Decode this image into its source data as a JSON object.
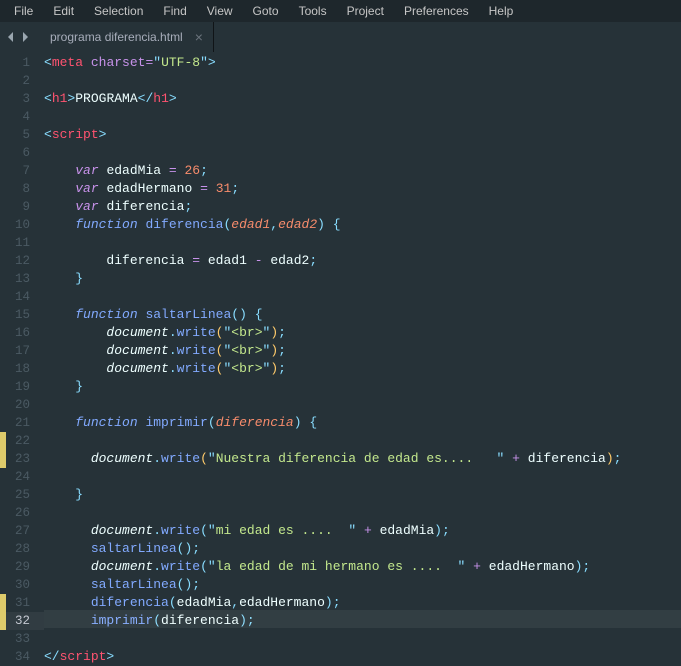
{
  "menu": {
    "items": [
      "File",
      "Edit",
      "Selection",
      "Find",
      "View",
      "Goto",
      "Tools",
      "Project",
      "Preferences",
      "Help"
    ]
  },
  "tab": {
    "name": "programa diferencia.html"
  },
  "gutter_total": 34,
  "active_line": 32,
  "dirty_lines": [
    22,
    23,
    31,
    32
  ],
  "code_lines": [
    "<span class='punct'>&lt;</span><span class='tag'>meta</span> <span class='attr'>charset</span><span class='op'>=</span><span class='punct'>\"</span><span class='str'>UTF-8</span><span class='punct'>\"</span><span class='punct'>&gt;</span>",
    "",
    "<span class='punct'>&lt;</span><span class='tag'>h1</span><span class='punct'>&gt;</span><span class='txt'>PROGRAMA</span><span class='punct'>&lt;/</span><span class='tag'>h1</span><span class='punct'>&gt;</span>",
    "",
    "<span class='punct'>&lt;</span><span class='tag'>script</span><span class='punct'>&gt;</span>",
    "",
    "    <span class='kw'>var</span> <span class='var'>edadMia</span> <span class='op'>=</span> <span class='num'>26</span><span class='punct'>;</span>",
    "    <span class='kw'>var</span> <span class='var'>edadHermano</span> <span class='op'>=</span> <span class='num'>31</span><span class='punct'>;</span>",
    "    <span class='kw'>var</span> <span class='var'>diferencia</span><span class='punct'>;</span>",
    "    <span class='vf'>function</span> <span class='fn'>diferencia</span><span class='bracket'>(</span><span class='param'>edad1</span><span class='punct'>,</span><span class='param'>edad2</span><span class='bracket'>)</span> <span class='bracket'>{</span>",
    "",
    "        <span class='var'>diferencia</span> <span class='op'>=</span> <span class='var'>edad1</span> <span class='op'>-</span> <span class='var'>edad2</span><span class='punct'>;</span>",
    "    <span class='bracket'>}</span>",
    "",
    "    <span class='vf'>function</span> <span class='fn'>saltarLinea</span><span class='bracket'>(</span><span class='bracket'>)</span> <span class='bracket'>{</span>",
    "        <span class='obj'>document</span><span class='punct'>.</span><span class='fn'>write</span><span class='bracket-a'>(</span><span class='punct'>\"</span><span class='str'>&lt;br&gt;</span><span class='punct'>\"</span><span class='bracket-a'>)</span><span class='punct'>;</span>",
    "        <span class='obj'>document</span><span class='punct'>.</span><span class='fn'>write</span><span class='bracket-a'>(</span><span class='punct'>\"</span><span class='str'>&lt;br&gt;</span><span class='punct'>\"</span><span class='bracket-a'>)</span><span class='punct'>;</span>",
    "        <span class='obj'>document</span><span class='punct'>.</span><span class='fn'>write</span><span class='bracket-a'>(</span><span class='punct'>\"</span><span class='str'>&lt;br&gt;</span><span class='punct'>\"</span><span class='bracket-a'>)</span><span class='punct'>;</span>",
    "    <span class='bracket'>}</span>",
    "",
    "    <span class='vf'>function</span> <span class='fn'>imprimir</span><span class='bracket'>(</span><span class='param'>diferencia</span><span class='bracket'>)</span> <span class='bracket'>{</span>",
    "",
    "      <span class='obj'>document</span><span class='punct'>.</span><span class='fn'>write</span><span class='bracket-a'>(</span><span class='punct'>\"</span><span class='str'>Nuestra diferencia de edad es....   </span><span class='punct'>\"</span> <span class='op'>+</span> <span class='var'>diferencia</span><span class='bracket-a'>)</span><span class='punct'>;</span>",
    "",
    "    <span class='bracket'>}</span>",
    "",
    "      <span class='obj'>document</span><span class='punct'>.</span><span class='fn'>write</span><span class='bracket'>(</span><span class='punct'>\"</span><span class='str'>mi edad es ....  </span><span class='punct'>\"</span> <span class='op'>+</span> <span class='var'>edadMia</span><span class='bracket'>)</span><span class='punct'>;</span>",
    "      <span class='fn'>saltarLinea</span><span class='bracket'>(</span><span class='bracket'>)</span><span class='punct'>;</span>",
    "      <span class='obj'>document</span><span class='punct'>.</span><span class='fn'>write</span><span class='bracket'>(</span><span class='punct'>\"</span><span class='str'>la edad de mi hermano es ....  </span><span class='punct'>\"</span> <span class='op'>+</span> <span class='var'>edadHermano</span><span class='bracket'>)</span><span class='punct'>;</span>",
    "      <span class='fn'>saltarLinea</span><span class='bracket'>(</span><span class='bracket'>)</span><span class='punct'>;</span>",
    "      <span class='fn'>diferencia</span><span class='bracket'>(</span><span class='var'>edadMia</span><span class='punct'>,</span><span class='var'>edadHermano</span><span class='bracket'>)</span><span class='punct'>;</span>",
    "      <span class='fn'>imprimir</span><span class='bracket'>(</span><span class='var'>diferencia</span><span class='bracket'>)</span><span class='punct'>;</span>",
    "",
    "<span class='punct'>&lt;/</span><span class='tag'>script</span><span class='punct'>&gt;</span>"
  ]
}
